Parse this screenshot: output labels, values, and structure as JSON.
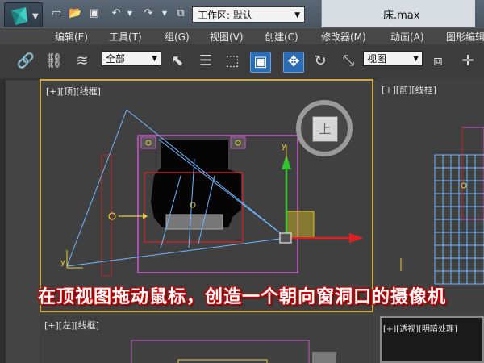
{
  "window": {
    "document_title": "床.max",
    "workspace_label": "工作区: 默认",
    "app_icon": "3dsmax-logo-icon"
  },
  "quick_access": [
    "new-icon",
    "open-icon",
    "save-icon",
    "undo-icon",
    "undo-dropdown-icon",
    "redo-icon",
    "redo-dropdown-icon",
    "project-folder-icon"
  ],
  "menu": [
    {
      "label": "编辑(E)"
    },
    {
      "label": "工具(T)"
    },
    {
      "label": "组(G)"
    },
    {
      "label": "视图(V)"
    },
    {
      "label": "创建(C)"
    },
    {
      "label": "修改器(M)"
    },
    {
      "label": "动画(A)"
    },
    {
      "label": "图形编辑器"
    }
  ],
  "toolbar": {
    "selection_filter": "全部",
    "reference_coord": "视图",
    "icons": [
      "select-and-link-icon",
      "unlink-icon",
      "bind-space-warp-icon",
      "select-object-icon",
      "select-by-name-icon",
      "rectangular-selection-icon",
      "window-crossing-icon",
      "select-and-move-icon",
      "select-and-rotate-icon",
      "select-and-scale-icon",
      "pivot-center-icon",
      "manipulate-icon"
    ]
  },
  "viewports": {
    "top": {
      "label": "[+][顶][线框]"
    },
    "front": {
      "label": "[+][前][线框]"
    },
    "left": {
      "label": "[+][左][线框]"
    },
    "perspective": {
      "label": "[+][透视][明暗处理]"
    }
  },
  "viewcube": {
    "face_label": "上"
  },
  "gizmo_axes": {
    "y": "y",
    "x": "x"
  },
  "caption": "在顶视图拖动鼠标，创造一个朝向窗洞口的摄像机",
  "colors": {
    "active_viewport_border": "#d2a845",
    "camera_cone": "#6fb6ff",
    "selection_box": "#c65ac8",
    "red_box": "#c0282b",
    "gizmo_y": "#2ec52e",
    "gizmo_x": "#e02020",
    "gizmo_plane": "#d8c020",
    "caption_outline": "#cc0000"
  }
}
